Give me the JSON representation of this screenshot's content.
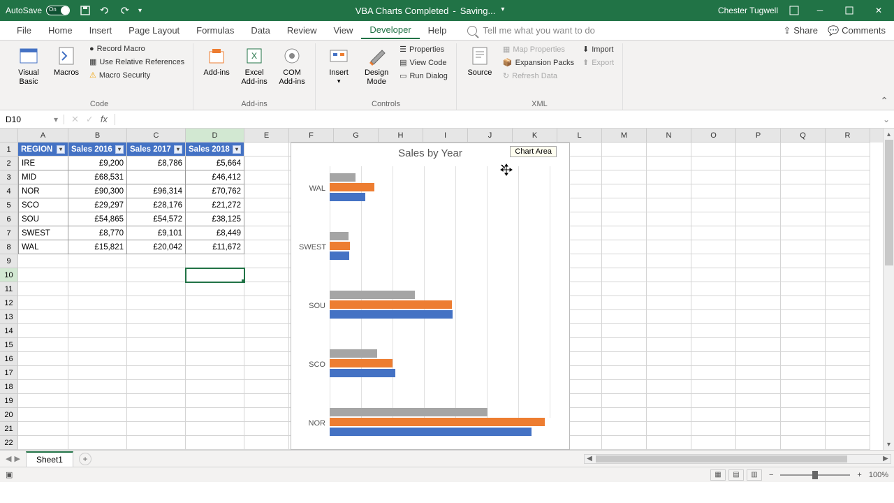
{
  "titlebar": {
    "autosave": "AutoSave",
    "autosave_state": "On",
    "doc_title": "VBA Charts Completed",
    "doc_status": "Saving...",
    "user": "Chester Tugwell"
  },
  "tabs": {
    "file": "File",
    "home": "Home",
    "insert": "Insert",
    "page_layout": "Page Layout",
    "formulas": "Formulas",
    "data": "Data",
    "review": "Review",
    "view": "View",
    "developer": "Developer",
    "help": "Help",
    "search_placeholder": "Tell me what you want to do",
    "share": "Share",
    "comments": "Comments"
  },
  "ribbon": {
    "code": {
      "vb": "Visual Basic",
      "macros": "Macros",
      "record": "Record Macro",
      "relative": "Use Relative References",
      "security": "Macro Security",
      "label": "Code"
    },
    "addins": {
      "addins": "Add-ins",
      "excel": "Excel Add-ins",
      "com": "COM Add-ins",
      "label": "Add-ins"
    },
    "controls": {
      "insert": "Insert",
      "design": "Design Mode",
      "props": "Properties",
      "view_code": "View Code",
      "run_dialog": "Run Dialog",
      "label": "Controls"
    },
    "xml": {
      "source": "Source",
      "map_props": "Map Properties",
      "expansion": "Expansion Packs",
      "refresh": "Refresh Data",
      "import": "Import",
      "export": "Export",
      "label": "XML"
    }
  },
  "formula_bar": {
    "name_box": "D10",
    "formula": ""
  },
  "columns": [
    "A",
    "B",
    "C",
    "D",
    "E",
    "F",
    "G",
    "H",
    "I",
    "J",
    "K",
    "L",
    "M",
    "N",
    "O",
    "P",
    "Q",
    "R"
  ],
  "table": {
    "headers": [
      "REGION",
      "Sales 2016",
      "Sales 2017",
      "Sales 2018"
    ],
    "rows": [
      {
        "r": "IRE",
        "a": "£9,200",
        "b": "£8,786",
        "c": "£5,664"
      },
      {
        "r": "MID",
        "a": "£68,531",
        "b": "",
        "c": "£46,412"
      },
      {
        "r": "NOR",
        "a": "£90,300",
        "b": "£96,314",
        "c": "£70,762"
      },
      {
        "r": "SCO",
        "a": "£29,297",
        "b": "£28,176",
        "c": "£21,272"
      },
      {
        "r": "SOU",
        "a": "£54,865",
        "b": "£54,572",
        "c": "£38,125"
      },
      {
        "r": "SWEST",
        "a": "£8,770",
        "b": "£9,101",
        "c": "£8,449"
      },
      {
        "r": "WAL",
        "a": "£15,821",
        "b": "£20,042",
        "c": "£11,672"
      }
    ]
  },
  "chart_tooltip": "Chart Area",
  "chart_data": {
    "type": "bar",
    "title": "Sales by Year",
    "categories": [
      "WAL",
      "SWEST",
      "SOU",
      "SCO",
      "NOR"
    ],
    "series": [
      {
        "name": "Sales 2018",
        "color": "#a5a5a5",
        "values": [
          11672,
          8449,
          38125,
          21272,
          70762
        ]
      },
      {
        "name": "Sales 2017",
        "color": "#ed7d31",
        "values": [
          20042,
          9101,
          54572,
          28176,
          96314
        ]
      },
      {
        "name": "Sales 2016",
        "color": "#4472c4",
        "values": [
          15821,
          8770,
          54865,
          29297,
          90300
        ]
      }
    ],
    "xlim": [
      0,
      100000
    ]
  },
  "sheet_tabs": {
    "sheet1": "Sheet1"
  },
  "status": {
    "zoom": "100%"
  }
}
